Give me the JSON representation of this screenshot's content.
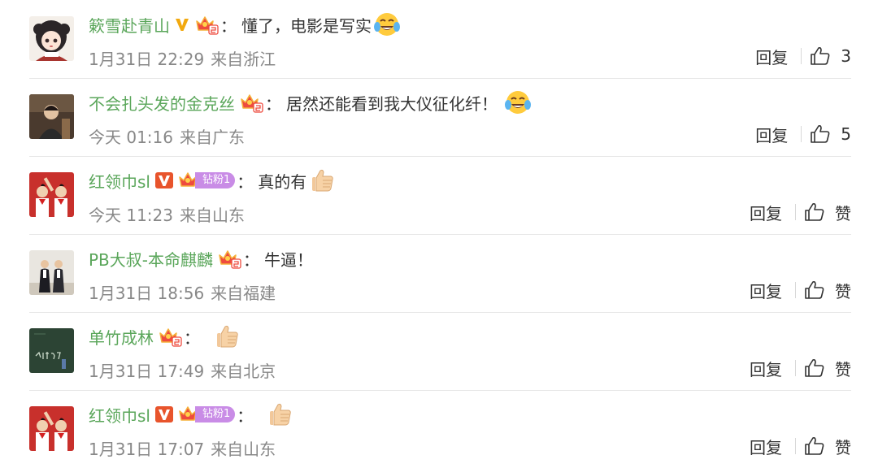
{
  "comments": [
    {
      "username": "簌雪赴青山",
      "has_v": true,
      "v_color": "#f2a90f",
      "has_crown": true,
      "fan_label": "",
      "text": "懂了，电影是写实",
      "emoji": "laugh-cry-emoji",
      "date": "1月31日 22:29",
      "location": "来自浙江",
      "reply_label": "回复",
      "like_label": "3"
    },
    {
      "username": "不会扎头发的金克丝",
      "has_v": false,
      "has_crown": true,
      "fan_label": "",
      "text": "居然还能看到我大仪征化纤！",
      "emoji": "laugh-cry-emoji",
      "date": "今天 01:16",
      "location": "来自广东",
      "reply_label": "回复",
      "like_label": "5"
    },
    {
      "username": "红领巾sl",
      "has_v": true,
      "v_color": "#e8542c",
      "has_crown": true,
      "fan_label": "钻粉1",
      "text": "真的有",
      "emoji": "thumbs-up-emoji",
      "date": "今天 11:23",
      "location": "来自山东",
      "reply_label": "回复",
      "like_label": "赞"
    },
    {
      "username": "PB大叔-本命麒麟",
      "has_v": false,
      "has_crown": true,
      "fan_label": "",
      "text": "牛逼！",
      "emoji": "",
      "date": "1月31日 18:56",
      "location": "来自福建",
      "reply_label": "回复",
      "like_label": "赞"
    },
    {
      "username": "单竹成林",
      "has_v": false,
      "has_crown": true,
      "fan_label": "",
      "text": "",
      "emoji": "thumbs-up-emoji",
      "date": "1月31日 17:49",
      "location": "来自北京",
      "reply_label": "回复",
      "like_label": "赞"
    },
    {
      "username": "红领巾sl",
      "has_v": true,
      "v_color": "#e8542c",
      "has_crown": true,
      "fan_label": "钻粉1",
      "text": "",
      "emoji": "thumbs-up-emoji",
      "date": "1月31日 17:07",
      "location": "来自山东",
      "reply_label": "回复",
      "like_label": "赞"
    }
  ],
  "colors": {
    "username": "#5aa65a",
    "meta_text": "#888888",
    "body_text": "#333333",
    "crown": "#ee4b3f",
    "crown_outline": "#f6b23a",
    "fan_pill": "#c98ce6",
    "separator": "#e6e6e6"
  },
  "colon": "："
}
